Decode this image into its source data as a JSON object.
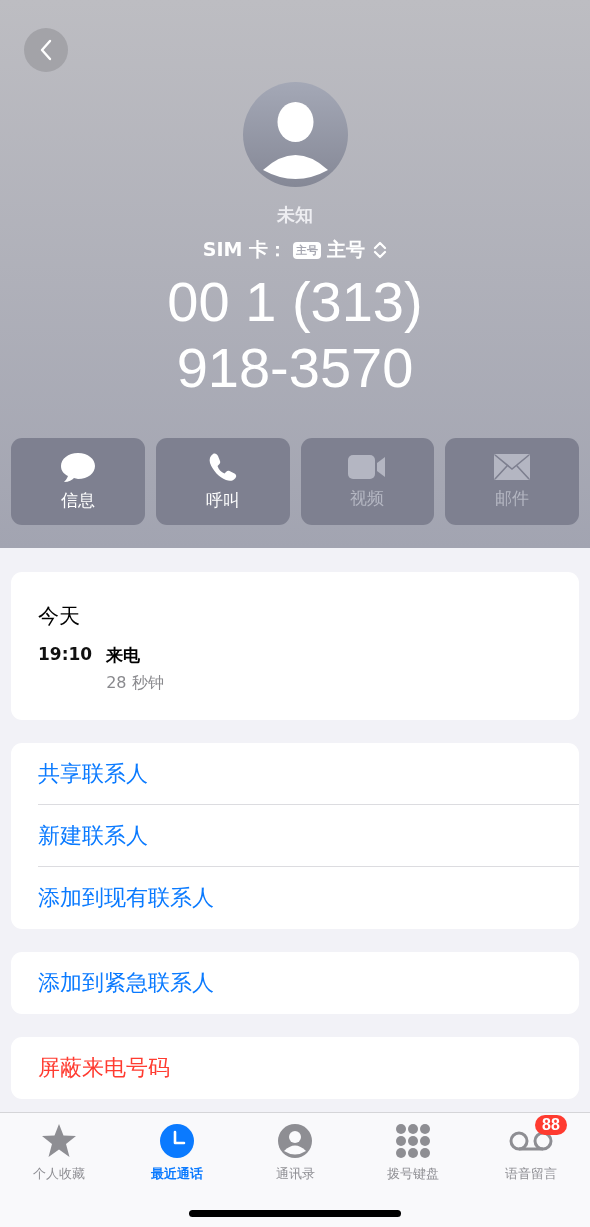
{
  "header": {
    "name": "未知",
    "sim_label": "SIM 卡：",
    "sim_badge": "主号",
    "sim_value": "主号",
    "number_lines": [
      "00 1 (313)",
      "918-3570"
    ]
  },
  "actions": [
    {
      "kind": "message",
      "label": "信息",
      "disabled": false
    },
    {
      "kind": "call",
      "label": "呼叫",
      "disabled": false
    },
    {
      "kind": "video",
      "label": "视频",
      "disabled": true
    },
    {
      "kind": "mail",
      "label": "邮件",
      "disabled": true
    }
  ],
  "history": {
    "day": "今天",
    "entries": [
      {
        "time": "19:10",
        "type": "来电",
        "duration": "28 秒钟"
      }
    ]
  },
  "option_groups": [
    [
      {
        "label": "共享联系人",
        "kind": "normal"
      },
      {
        "label": "新建联系人",
        "kind": "normal"
      },
      {
        "label": "添加到现有联系人",
        "kind": "normal"
      }
    ],
    [
      {
        "label": "添加到紧急联系人",
        "kind": "normal"
      }
    ],
    [
      {
        "label": "屏蔽来电号码",
        "kind": "destructive"
      }
    ]
  ],
  "tab_bar": [
    {
      "kind": "favorites",
      "label": "个人收藏",
      "selected": false
    },
    {
      "kind": "recents",
      "label": "最近通话",
      "selected": true
    },
    {
      "kind": "contacts",
      "label": "通讯录",
      "selected": false
    },
    {
      "kind": "keypad",
      "label": "拨号键盘",
      "selected": false
    },
    {
      "kind": "voicemail",
      "label": "语音留言",
      "selected": false,
      "badge": "88"
    }
  ]
}
